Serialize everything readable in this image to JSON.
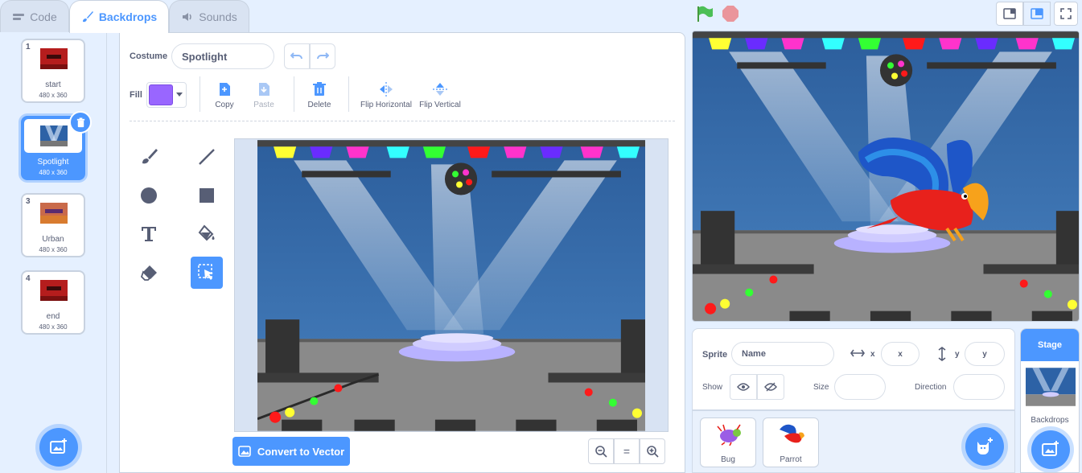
{
  "tabs": [
    {
      "label": "Code",
      "icon": "code-icon"
    },
    {
      "label": "Backdrops",
      "icon": "paintbrush-icon"
    },
    {
      "label": "Sounds",
      "icon": "speaker-icon"
    }
  ],
  "costumes": [
    {
      "number": "1",
      "name": "start",
      "size": "480 x 360"
    },
    {
      "number": "2",
      "name": "Spotlight",
      "size": "480 x 360"
    },
    {
      "number": "3",
      "name": "Urban",
      "size": "480 x 360"
    },
    {
      "number": "4",
      "name": "end",
      "size": "480 x 360"
    }
  ],
  "editor": {
    "costume_label": "Costume",
    "costume_name": "Spotlight",
    "fill_label": "Fill",
    "fill_color": "#9966FF",
    "copy": "Copy",
    "paste": "Paste",
    "delete": "Delete",
    "flip_h": "Flip Horizontal",
    "flip_v": "Flip Vertical",
    "convert": "Convert to Vector",
    "zoom_reset": "="
  },
  "sprite_info": {
    "sprite_label": "Sprite",
    "name_placeholder": "Name",
    "x_label": "x",
    "x_placeholder": "x",
    "y_label": "y",
    "y_placeholder": "y",
    "show_label": "Show",
    "size_label": "Size",
    "direction_label": "Direction"
  },
  "sprites": [
    {
      "name": "Bug"
    },
    {
      "name": "Parrot"
    }
  ],
  "stage_panel": {
    "header": "Stage",
    "backdrops_label": "Backdrops"
  },
  "colors": {
    "accent": "#4c97ff",
    "fill": "#9966FF"
  }
}
